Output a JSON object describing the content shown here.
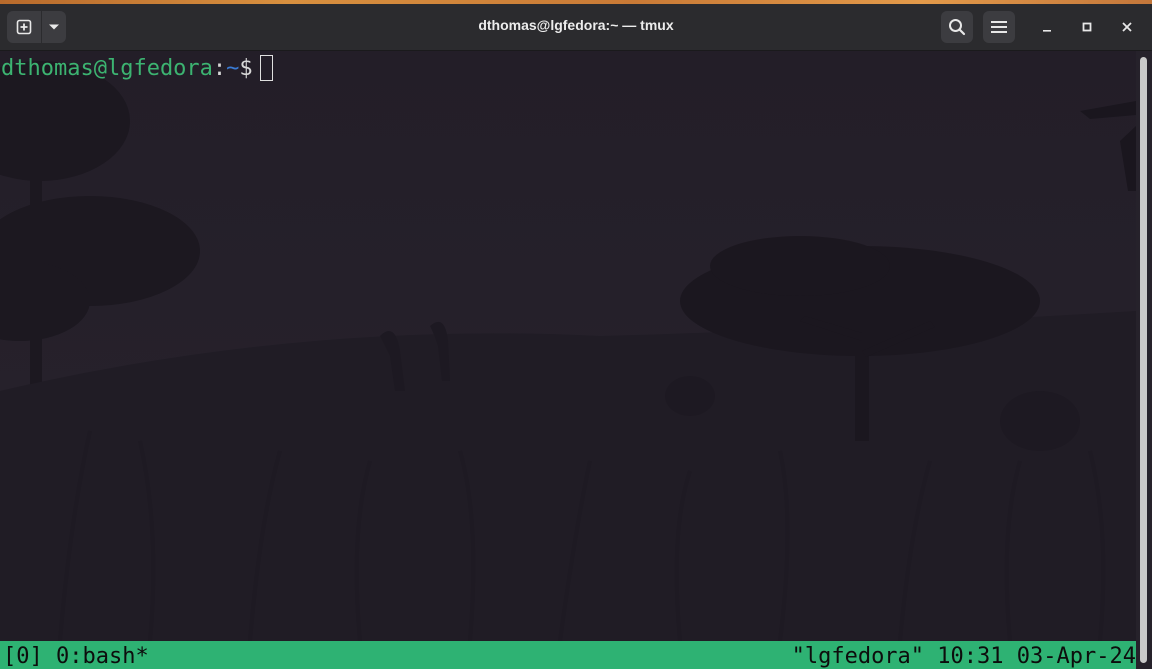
{
  "window": {
    "title": "dthomas@lgfedora:~ — tmux"
  },
  "header": {
    "new_tab_icon": "new-tab-plus-icon",
    "new_tab_menu_icon": "chevron-down-icon",
    "search_icon": "search-icon",
    "menu_icon": "hamburger-menu-icon",
    "minimize_icon": "minimize-icon",
    "maximize_icon": "maximize-icon",
    "close_icon": "close-icon"
  },
  "terminal": {
    "prompt_user_host": "dthomas@lgfedora",
    "prompt_separator": ":",
    "prompt_path": "~",
    "prompt_symbol": "$",
    "colors": {
      "background": "#211d26",
      "user_host": "#3cb371",
      "path": "#3a7bd5",
      "text": "#d7d7d7"
    }
  },
  "tmux": {
    "session": "[0]",
    "window": "0:bash*",
    "host": "\"lgfedora\"",
    "time": "10:31",
    "date": "03-Apr-24",
    "color": "#2eb273"
  }
}
